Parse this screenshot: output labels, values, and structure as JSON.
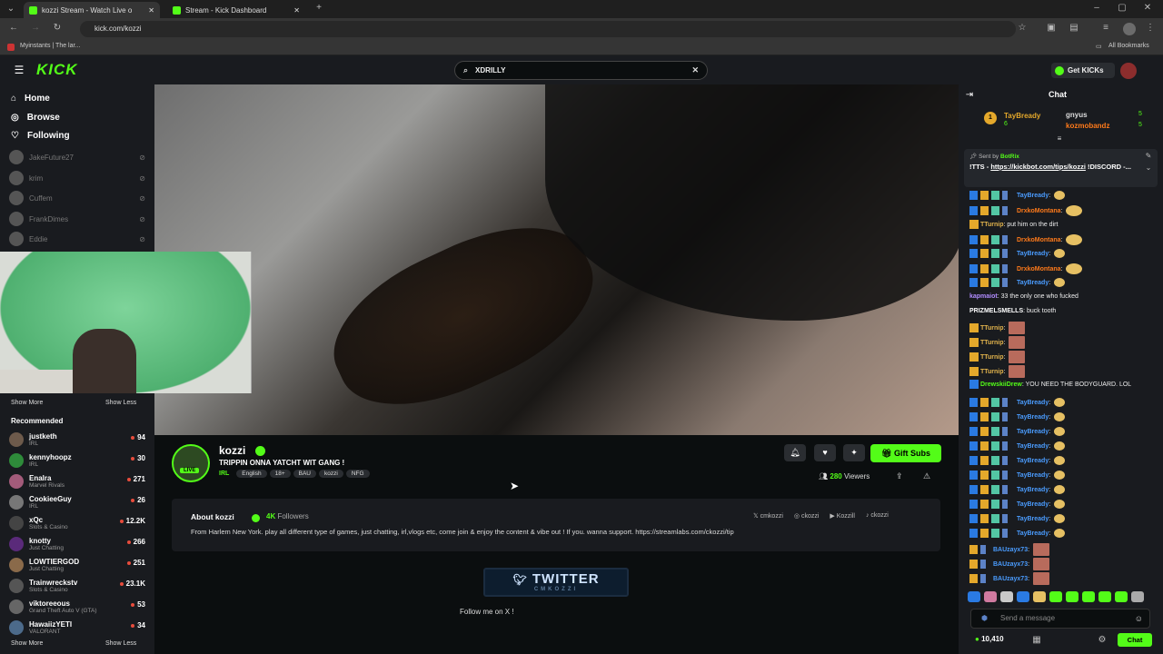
{
  "browser": {
    "tabs": [
      {
        "title": "kozzi Stream - Watch Live o"
      },
      {
        "title": "Stream - Kick Dashboard"
      }
    ],
    "url": "kick.com/kozzi",
    "bookmark_left": "Myinstants | The lar...",
    "bookmark_right": "All Bookmarks"
  },
  "header": {
    "logo": "KICK",
    "search_value": "XDRILLY",
    "get_kicks": "Get KICKs"
  },
  "sidebar": {
    "nav": [
      {
        "label": "Home",
        "icon": "home-icon"
      },
      {
        "label": "Browse",
        "icon": "compass-icon"
      },
      {
        "label": "Following",
        "icon": "heart-icon"
      }
    ],
    "following": [
      "JakeFuture27",
      "krim",
      "Cuffem",
      "FrankDimes",
      "Eddie"
    ],
    "show_more": "Show More",
    "show_less": "Show Less",
    "recommended_title": "Recommended",
    "recommended": [
      {
        "name": "justketh",
        "category": "IRL",
        "viewers": "94"
      },
      {
        "name": "kennyhoopz",
        "category": "IRL",
        "viewers": "30"
      },
      {
        "name": "Enalra",
        "category": "Marvel Rivals",
        "viewers": "271"
      },
      {
        "name": "CookieeGuy",
        "category": "IRL",
        "viewers": "26"
      },
      {
        "name": "xQc",
        "category": "Slots & Casino",
        "viewers": "12.2K"
      },
      {
        "name": "knotty",
        "category": "Just Chatting",
        "viewers": "266"
      },
      {
        "name": "LOWTIERGOD",
        "category": "Just Chatting",
        "viewers": "251"
      },
      {
        "name": "Trainwreckstv",
        "category": "Slots & Casino",
        "viewers": "23.1K"
      },
      {
        "name": "viktoreeous",
        "category": "Grand Theft Auto V (GTA)",
        "viewers": "53"
      },
      {
        "name": "HawaiizYETI",
        "category": "VALORANT",
        "viewers": "34"
      }
    ],
    "show_more_2": "Show More",
    "show_less_2": "Show Less"
  },
  "channel": {
    "name": "kozzi",
    "live_badge": "LIVE",
    "title": "TRIPPIN ONNA YATCHT WIT GANG !",
    "category": "IRL",
    "tags": [
      "English",
      "18+",
      "BAU",
      "kozzi",
      "NFG"
    ],
    "gift_subs": "Gift Subs",
    "viewers": "280",
    "viewers_label": "Viewers"
  },
  "about": {
    "title": "About kozzi",
    "followers": "4K",
    "followers_label": "Followers",
    "socials": [
      "cmkozzi",
      "ckozzi",
      "Kozzill",
      "ckozzi"
    ],
    "bio": "From Harlem New York. play all different type of games, just chatting, irl,vlogs etc, come join & enjoy the content & vibe out ! If you. wanna support. https://streamlabs.com/ckozzi/tip",
    "panel_title": "TWITTER",
    "panel_sub": "CMKOZZI",
    "panel_caption": "Follow me on X !"
  },
  "chat": {
    "title": "Chat",
    "top_gifters": [
      {
        "name": "TayBready",
        "count": "6",
        "rank": "1"
      },
      {
        "name": "gnyus",
        "count": "5"
      },
      {
        "name": "kozmobandz",
        "count": "5"
      }
    ],
    "pinned_sender_label": "Sent by",
    "pinned_sender": "BotRix",
    "pinned_text_prefix": "!TTS - ",
    "pinned_link": "https://kickbot.com/tips/kozzi",
    "pinned_text_suffix": "!DISCORD -...",
    "messages": [
      {
        "user": "TayBready",
        "text": "",
        "color": "#4a9cff",
        "badges": "full",
        "emote": "smile"
      },
      {
        "user": "DrxkoMontana",
        "text": "",
        "color": "#ff7a1a",
        "badges": "full",
        "emote": "laugh"
      },
      {
        "user": "TTurnip",
        "text": "put him on the dirt",
        "color": "#e0b24c",
        "badges": "one",
        "emote": ""
      },
      {
        "user": "DrxkoMontana",
        "text": "",
        "color": "#ff7a1a",
        "badges": "full",
        "emote": "laugh"
      },
      {
        "user": "TayBready",
        "text": "",
        "color": "#4a9cff",
        "badges": "full",
        "emote": "smile"
      },
      {
        "user": "DrxkoMontana",
        "text": "",
        "color": "#ff7a1a",
        "badges": "full",
        "emote": "laugh"
      },
      {
        "user": "TayBready",
        "text": "",
        "color": "#4a9cff",
        "badges": "full",
        "emote": "smile"
      },
      {
        "user": "kapmaiot",
        "text": "33 the only one who fucked",
        "color": "#b18cff",
        "badges": "",
        "emote": ""
      },
      {
        "user": "PRIZMELSMELLS",
        "text": "buck tooth",
        "color": "#ffffff",
        "badges": "",
        "emote": ""
      },
      {
        "user": "TTurnip",
        "text": "",
        "color": "#e0b24c",
        "badges": "one",
        "emote": "pic"
      },
      {
        "user": "TTurnip",
        "text": "",
        "color": "#e0b24c",
        "badges": "one",
        "emote": "pic"
      },
      {
        "user": "TTurnip",
        "text": "",
        "color": "#e0b24c",
        "badges": "one",
        "emote": "pic"
      },
      {
        "user": "TTurnip",
        "text": "",
        "color": "#e0b24c",
        "badges": "one",
        "emote": "pic"
      },
      {
        "user": "DrewskiiDrew",
        "text": "YOU NEED THE BODYGUARD. LOL",
        "color": "#53fc18",
        "badges": "blue",
        "emote": ""
      },
      {
        "user": "TayBready",
        "text": "",
        "color": "#4a9cff",
        "badges": "full",
        "emote": "smile"
      },
      {
        "user": "TayBready",
        "text": "",
        "color": "#4a9cff",
        "badges": "full",
        "emote": "smile"
      },
      {
        "user": "TayBready",
        "text": "",
        "color": "#4a9cff",
        "badges": "full",
        "emote": "smile"
      },
      {
        "user": "TayBready",
        "text": "",
        "color": "#4a9cff",
        "badges": "full",
        "emote": "smile"
      },
      {
        "user": "TayBready",
        "text": "",
        "color": "#4a9cff",
        "badges": "full",
        "emote": "smile"
      },
      {
        "user": "TayBready",
        "text": "",
        "color": "#4a9cff",
        "badges": "full",
        "emote": "smile"
      },
      {
        "user": "TayBready",
        "text": "",
        "color": "#4a9cff",
        "badges": "full",
        "emote": "smile"
      },
      {
        "user": "TayBready",
        "text": "",
        "color": "#4a9cff",
        "badges": "full",
        "emote": "smile"
      },
      {
        "user": "TayBready",
        "text": "",
        "color": "#4a9cff",
        "badges": "full",
        "emote": "smile"
      },
      {
        "user": "TayBready",
        "text": "",
        "color": "#4a9cff",
        "badges": "full",
        "emote": "smile"
      },
      {
        "user": "BAUzayx73",
        "text": "",
        "color": "#4a9cff",
        "badges": "two",
        "emote": "pic"
      },
      {
        "user": "BAUzayx73",
        "text": "",
        "color": "#4a9cff",
        "badges": "two",
        "emote": "pic"
      },
      {
        "user": "BAUzayx73",
        "text": "",
        "color": "#4a9cff",
        "badges": "two",
        "emote": "pic"
      }
    ],
    "input_placeholder": "Send a message",
    "kicks_balance": "10,410",
    "chat_button": "Chat"
  },
  "colors": {
    "accent": "#53fc18",
    "background": "#0b0e0f",
    "panel": "#191b1f"
  }
}
